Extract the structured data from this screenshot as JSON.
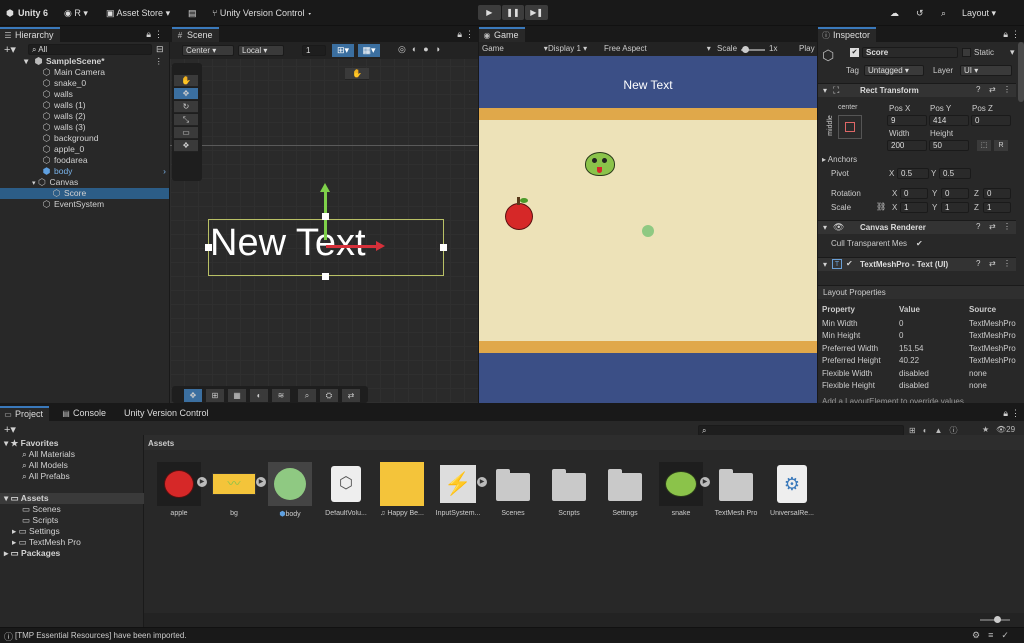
{
  "toolbar": {
    "app": "Unity 6",
    "account": "R",
    "asset_store": "Asset Store",
    "vcs": "Unity Version Control",
    "layout": "Layout",
    "play": "▶",
    "pause": "❚❚",
    "step": "▶❚"
  },
  "hierarchy": {
    "tab": "Hierarchy",
    "search_placeholder": "All",
    "scene": "SampleScene*",
    "items": [
      "Main Camera",
      "snake_0",
      "walls",
      "walls (1)",
      "walls (2)",
      "walls (3)",
      "background",
      "apple_0",
      "foodarea",
      "body",
      "Canvas",
      "Score",
      "EventSystem"
    ]
  },
  "scene": {
    "tab": "Scene",
    "pivot": "Center",
    "space": "Local",
    "grid_snap": "1",
    "text": "New Text"
  },
  "game": {
    "tab": "Game",
    "view": "Game",
    "display": "Display 1",
    "aspect": "Free Aspect",
    "scale_label": "Scale",
    "scale_value": "1x",
    "play_label": "Play",
    "score_text": "New Text"
  },
  "inspector": {
    "tab": "Inspector",
    "name": "Score",
    "static": "Static",
    "tag_label": "Tag",
    "tag": "Untagged",
    "layer_label": "Layer",
    "layer": "UI",
    "rect": {
      "title": "Rect Transform",
      "anchor": "center",
      "anchor_side": "middle",
      "pos_x_label": "Pos X",
      "pos_y_label": "Pos Y",
      "pos_z_label": "Pos Z",
      "pos_x": "9",
      "pos_y": "414",
      "pos_z": "0",
      "width_label": "Width",
      "height_label": "Height",
      "width": "200",
      "height": "50",
      "r_btn": "R",
      "anchors": "Anchors",
      "pivot": "Pivot",
      "pivot_x": "0.5",
      "pivot_y": "0.5",
      "rotation": "Rotation",
      "rot_x": "0",
      "rot_y": "0",
      "rot_z": "0",
      "scale": "Scale",
      "sc_x": "1",
      "sc_y": "1",
      "sc_z": "1",
      "x": "X",
      "y": "Y",
      "z": "Z"
    },
    "canvas_renderer": {
      "title": "Canvas Renderer",
      "cull": "Cull Transparent Mes"
    },
    "tmp": {
      "title": "TextMeshPro - Text (UI)"
    },
    "layout": {
      "title": "Layout Properties",
      "headers": [
        "Property",
        "Value",
        "Source"
      ],
      "rows": [
        [
          "Min Width",
          "0",
          "TextMeshPro"
        ],
        [
          "Min Height",
          "0",
          "TextMeshPro"
        ],
        [
          "Preferred Width",
          "151.54",
          "TextMeshPro"
        ],
        [
          "Preferred Height",
          "40.22",
          "TextMeshPro"
        ],
        [
          "Flexible Width",
          "disabled",
          "none"
        ],
        [
          "Flexible Height",
          "disabled",
          "none"
        ]
      ],
      "footer": "Add a LayoutElement to override values"
    }
  },
  "project": {
    "tabs": [
      "Project",
      "Console",
      "Unity Version Control"
    ],
    "count": "29",
    "favorites": "Favorites",
    "fav_items": [
      "All Materials",
      "All Models",
      "All Prefabs"
    ],
    "assets": "Assets",
    "asset_folders": [
      "Scenes",
      "Scripts",
      "Settings",
      "TextMesh Pro"
    ],
    "packages": "Packages",
    "breadcrumb": "Assets",
    "grid": [
      "apple",
      "bg",
      "body",
      "DefaultVolu...",
      "Happy Be...",
      "InputSystem...",
      "Scenes",
      "Scripts",
      "Settings",
      "snake",
      "TextMesh Pro",
      "UniversalRe..."
    ]
  },
  "status": {
    "message": "[TMP Essential Resources] have been imported."
  },
  "colors": {
    "accent": "#3a79bb",
    "selection": "#2c5d87",
    "game_blue": "#3b4f86",
    "game_orange": "#e0a84a",
    "game_sand": "#ede2b8",
    "apple_red": "#d62828",
    "snake_green": "#8bc34a",
    "body_green": "#8fc982"
  }
}
